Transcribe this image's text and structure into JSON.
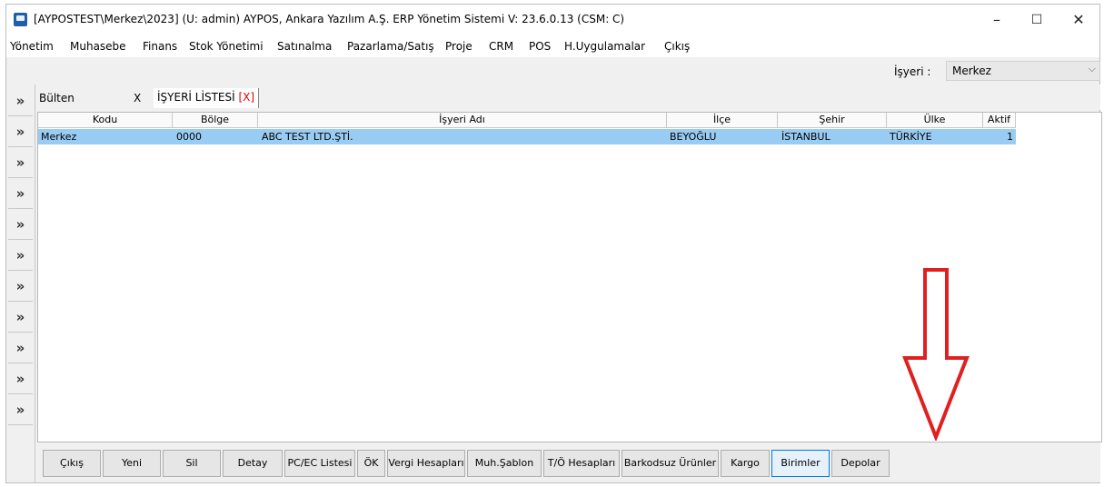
{
  "window": {
    "title": "[AYPOSTEST\\Merkez\\2023] (U: admin) AYPOS, Ankara Yazılım A.Ş. ERP Yönetim Sistemi V: 23.6.0.13 (CSM: C)",
    "minimize": "–",
    "maximize": "☐",
    "close": "✕"
  },
  "menu": [
    "Yönetim",
    "Muhasebe",
    "Finans",
    "Stok Yönetimi",
    "Satınalma",
    "Pazarlama/Satış",
    "Proje",
    "CRM",
    "POS",
    "H.Uygulamalar",
    "Çıkış"
  ],
  "isyeri": {
    "label": "İşyeri :",
    "value": "Merkez"
  },
  "sidebar": {
    "button": "»"
  },
  "tabs": {
    "bulten": "Bülten",
    "bulten_close": "X",
    "active": "İŞYERİ LİSTESİ",
    "active_close": "[X]"
  },
  "table": {
    "columns": [
      "Kodu",
      "Bölge",
      "İşyeri Adı",
      "İlçe",
      "Şehir",
      "Ülke",
      "Aktif"
    ],
    "rows": [
      [
        "Merkez",
        "0000",
        "ABC TEST LTD.ŞTİ.",
        "BEYOĞLU",
        "İSTANBUL",
        "TÜRKİYE",
        "1"
      ]
    ]
  },
  "buttons": [
    "Çıkış",
    "Yeni",
    "Sil",
    "Detay",
    "PC/EC Listesi",
    "ÖK",
    "Vergi Hesapları",
    "Muh.Şablon",
    "T/Ö Hesapları",
    "Barkodsuz Ürünler",
    "Kargo",
    "Birimler",
    "Depolar"
  ],
  "colors": {
    "selected_row": "#99ccf3",
    "annotation_arrow": "#e02020"
  }
}
